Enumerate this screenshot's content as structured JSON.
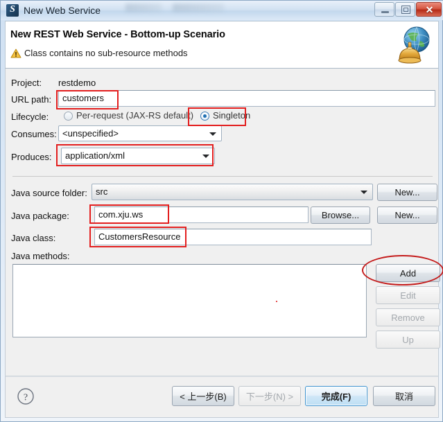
{
  "window": {
    "title": "New Web Service",
    "icon": "web-service-icon",
    "controls": {
      "minimize": "minimize-icon",
      "restore": "restore-icon",
      "close": "✕"
    }
  },
  "header": {
    "title": "New REST Web Service - Bottom-up Scenario",
    "message": "Class contains no sub-resource methods",
    "status_icon": "warning-icon",
    "banner_icon": "globe-service-icon"
  },
  "form": {
    "project": {
      "label": "Project:",
      "value": "restdemo"
    },
    "url_path": {
      "label": "URL path:",
      "value": "customers"
    },
    "lifecycle": {
      "label": "Lifecycle:",
      "options": [
        {
          "label": "Per-request (JAX-RS default)",
          "selected": false
        },
        {
          "label": "Singleton",
          "selected": true
        }
      ]
    },
    "consumes": {
      "label": "Consumes:",
      "value": "<unspecified>"
    },
    "produces": {
      "label": "Produces:",
      "value": "application/xml"
    },
    "java_source_folder": {
      "label": "Java source folder:",
      "value": "src",
      "button": "New..."
    },
    "java_package": {
      "label": "Java package:",
      "value": "com.xju.ws",
      "browse_button": "Browse...",
      "new_button": "New..."
    },
    "java_class": {
      "label": "Java class:",
      "value": "CustomersResource"
    },
    "java_methods": {
      "label": "Java methods:",
      "items": [],
      "buttons": [
        {
          "label": "Add",
          "enabled": true
        },
        {
          "label": "Edit",
          "enabled": false
        },
        {
          "label": "Remove",
          "enabled": false
        },
        {
          "label": "Up",
          "enabled": false
        }
      ]
    }
  },
  "footer": {
    "help_icon": "help-icon",
    "buttons": [
      {
        "label": "< 上一步(B)",
        "enabled": true,
        "default": false
      },
      {
        "label": "下一步(N) >",
        "enabled": false,
        "default": false
      },
      {
        "label": "完成(F)",
        "enabled": true,
        "default": true
      },
      {
        "label": "取消",
        "enabled": true,
        "default": false
      }
    ]
  },
  "annotations": {
    "color": "#e31e1e",
    "boxes": [
      "url-path-field",
      "singleton-radio",
      "produces-combo",
      "java-package-field",
      "java-class-field"
    ],
    "ellipse": "add-button"
  }
}
